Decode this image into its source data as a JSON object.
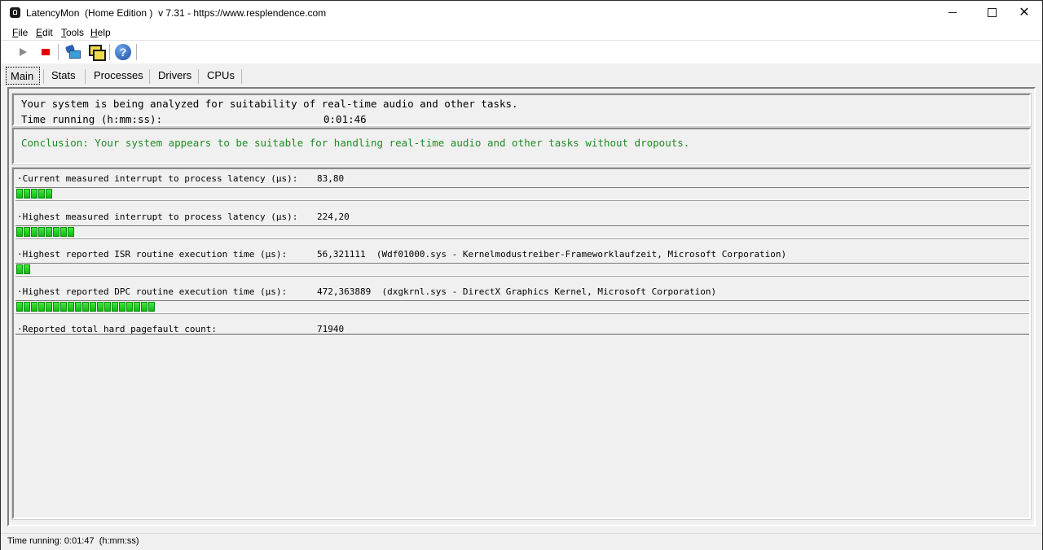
{
  "window": {
    "title": "LatencyMon  (Home Edition )  v 7.31 - https://www.resplendence.com",
    "controls": {
      "minimize_icon": "minimize-icon",
      "maximize_icon": "maximize-icon",
      "close_glyph": "✕"
    }
  },
  "menu": [
    "File",
    "Edit",
    "Tools",
    "Help"
  ],
  "toolbar": {
    "icons": [
      "play-icon",
      "stop-icon",
      "tool-icon",
      "windows-icon",
      "help-icon"
    ],
    "colors": {
      "stop": "#e60000",
      "help": "#1f4f9e"
    }
  },
  "tabs": [
    {
      "label": "Main",
      "active": true
    },
    {
      "label": "Stats",
      "active": false
    },
    {
      "label": "Processes",
      "active": false
    },
    {
      "label": "Drivers",
      "active": false
    },
    {
      "label": "CPUs",
      "active": false
    }
  ],
  "status": {
    "line1": "Your system is being analyzed for suitability of real-time audio and other tasks.",
    "time_label": "Time running (h:mm:ss):",
    "time_value": "0:01:46"
  },
  "conclusion": {
    "text": "Conclusion: Your system appears to be suitable for handling real-time audio and other tasks without dropouts.",
    "color": "#1f8b25"
  },
  "metrics": [
    {
      "label": "·Current measured interrupt to process latency (µs):",
      "value": "83,80",
      "detail": "",
      "bar_segments": 5
    },
    {
      "label": "·Highest measured interrupt to process latency (µs):",
      "value": "224,20",
      "detail": "",
      "bar_segments": 8
    },
    {
      "label": "·Highest reported ISR routine execution time (µs):",
      "value": "56,321111",
      "detail": "(Wdf01000.sys - Kernelmodustreiber-Frameworklaufzeit, Microsoft Corporation)",
      "bar_segments": 2
    },
    {
      "label": "·Highest reported DPC routine execution time (µs):",
      "value": "472,363889",
      "detail": "(dxgkrnl.sys - DirectX Graphics Kernel, Microsoft Corporation)",
      "bar_segments": 19
    },
    {
      "label": "·Reported total hard pagefault count:",
      "value": "71940",
      "detail": "",
      "bar_segments": 0
    }
  ],
  "bar_color": "#1fc41f",
  "statusbar": {
    "text": "Time running: 0:01:47  (h:mm:ss)"
  }
}
